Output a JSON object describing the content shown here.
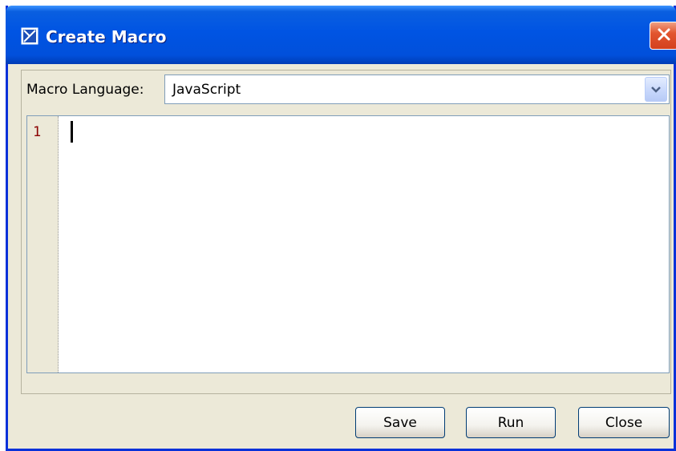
{
  "window": {
    "title": "Create Macro",
    "icon": "macro-icon",
    "close_icon": "close-icon"
  },
  "macro_language": {
    "label": "Macro Language:",
    "selected": "JavaScript",
    "dropdown_icon": "chevron-down-icon"
  },
  "editor": {
    "line_numbers": [
      "1"
    ],
    "content": ""
  },
  "buttons": {
    "save": "Save",
    "run": "Run",
    "close": "Close"
  },
  "colors": {
    "titlebar": "#0054e3",
    "window_bg": "#ece9d8",
    "close_button": "#e2562f",
    "line_number": "#8b0000"
  }
}
